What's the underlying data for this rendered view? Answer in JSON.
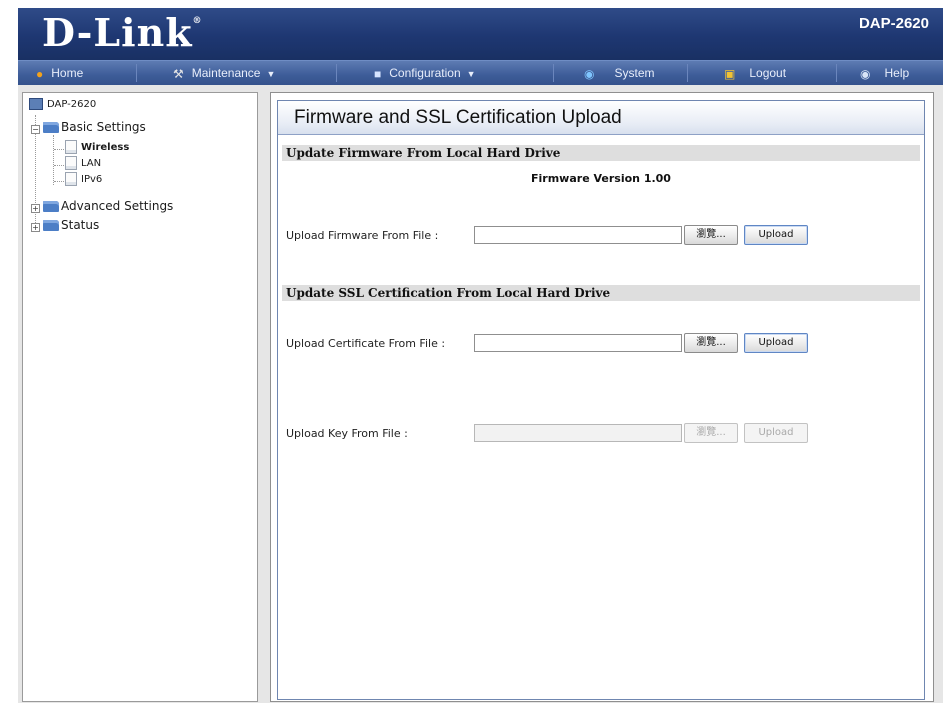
{
  "header": {
    "logo": "D-Link",
    "logo_mark": "®",
    "model": "DAP-2620"
  },
  "menu": [
    {
      "label": "Home",
      "icon": "home-icon",
      "dropdown": false
    },
    {
      "label": "Maintenance",
      "icon": "tools-icon",
      "dropdown": true
    },
    {
      "label": "Configuration",
      "icon": "config-icon",
      "dropdown": true
    },
    {
      "label": "System",
      "icon": "globe-icon",
      "dropdown": false
    },
    {
      "label": "Logout",
      "icon": "logout-icon",
      "dropdown": false
    },
    {
      "label": "Help",
      "icon": "help-icon",
      "dropdown": false
    }
  ],
  "tree": {
    "root": "DAP-2620",
    "basic_settings": "Basic Settings",
    "basic_children": [
      "Wireless",
      "LAN",
      "IPv6"
    ],
    "advanced_settings": "Advanced Settings",
    "status": "Status"
  },
  "page": {
    "title": "Firmware and SSL Certification Upload",
    "firmware_section": "Update Firmware From Local Hard Drive",
    "firmware_version": "Firmware Version 1.00",
    "upload_firmware_label": "Upload Firmware From File :",
    "ssl_section": "Update SSL Certification From Local Hard Drive",
    "upload_cert_label": "Upload Certificate From File :",
    "upload_key_label": "Upload Key From File :",
    "browse_label": "瀏覽...",
    "upload_label": "Upload"
  },
  "colors": {
    "header": "#1e3772",
    "menubar": "#3d5c98",
    "section_bar": "#dedede"
  }
}
